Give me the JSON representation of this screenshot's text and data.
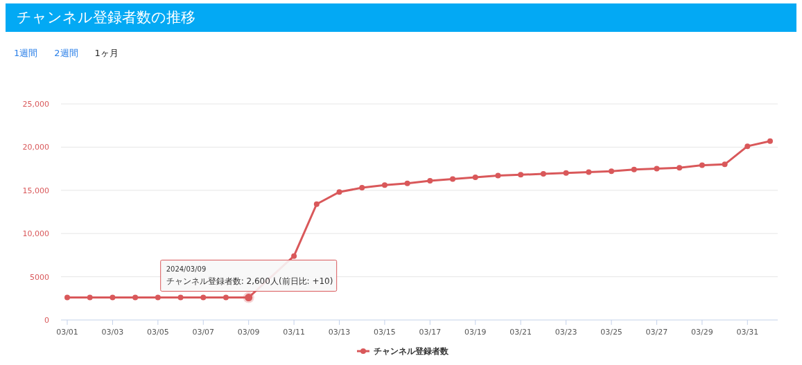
{
  "header": {
    "title": "チャンネル登録者数の推移"
  },
  "tabs": [
    {
      "label": "1週間",
      "selected": false
    },
    {
      "label": "2週間",
      "selected": false
    },
    {
      "label": "1ヶ月",
      "selected": true
    }
  ],
  "chart": {
    "chart_data": {
      "type": "line",
      "categories": [
        "03/01",
        null,
        "03/03",
        null,
        "03/05",
        null,
        "03/07",
        null,
        "03/09",
        null,
        "03/11",
        null,
        "03/13",
        null,
        "03/15",
        null,
        "03/17",
        null,
        "03/19",
        null,
        "03/21",
        null,
        "03/23",
        null,
        "03/25",
        null,
        "03/27",
        null,
        "03/29",
        null,
        "03/31",
        null
      ],
      "grid": true,
      "series": [
        {
          "name": "チャンネル登録者数",
          "color": "#d9585a",
          "marker": "circle",
          "values": [
            2600,
            2600,
            2600,
            2600,
            2600,
            2600,
            2600,
            2600,
            2600,
            null,
            7400,
            13400,
            14800,
            15300,
            15600,
            15800,
            16100,
            16300,
            16500,
            16700,
            16800,
            16900,
            17000,
            17100,
            17200,
            17400,
            17500,
            17600,
            17900,
            18000,
            20100,
            20700
          ]
        }
      ],
      "ylim": [
        0,
        25000
      ],
      "yticks": [
        0,
        {
          "value": 5000,
          "label": "5000"
        },
        {
          "value": 10000,
          "label": "10,000"
        },
        {
          "value": 15000,
          "label": "15,000"
        },
        {
          "value": 20000,
          "label": "20,000"
        },
        {
          "value": 25000,
          "label": "25,000"
        }
      ],
      "annotations": [
        "チャンネル登録者数: 2,600人(前日比: +10)"
      ]
    },
    "tooltip": {
      "date": "2024/03/09"
    }
  }
}
